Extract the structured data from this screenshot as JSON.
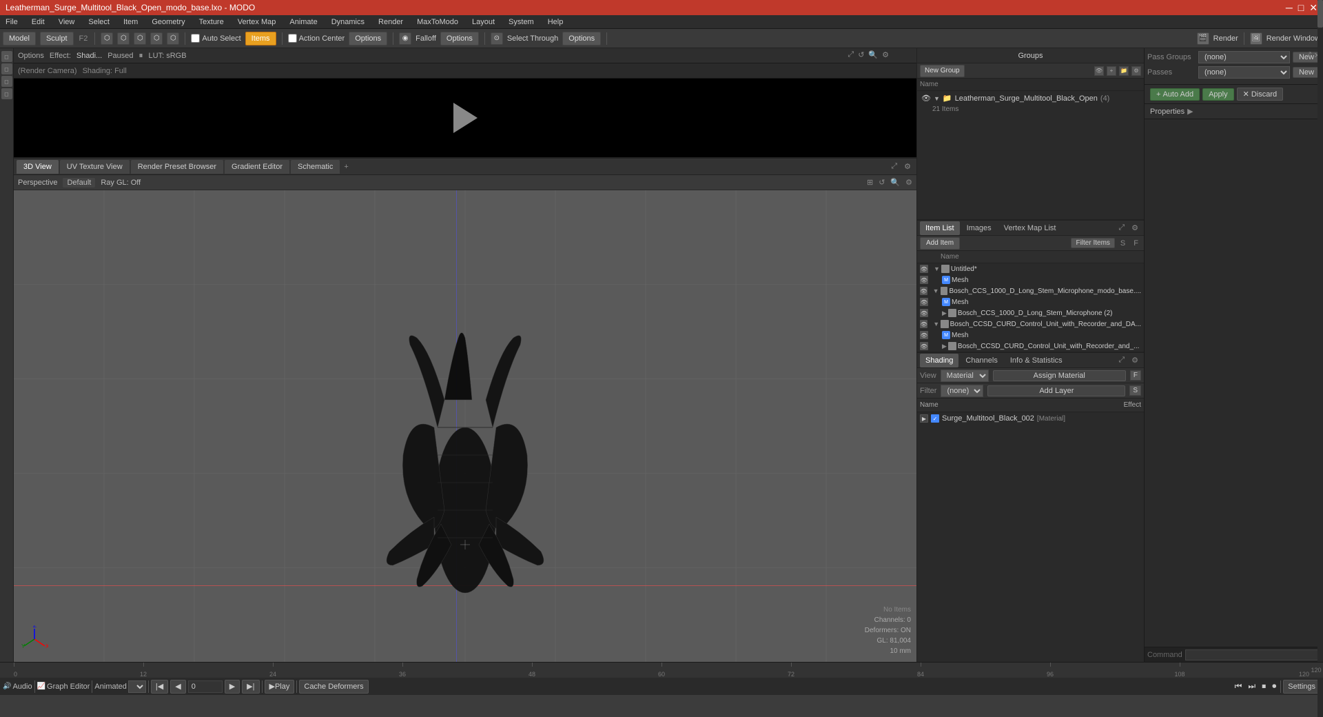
{
  "titlebar": {
    "title": "Leatherman_Surge_Multitool_Black_Open_modo_base.lxo - MODO",
    "controls": [
      "─",
      "□",
      "✕"
    ]
  },
  "menubar": {
    "items": [
      "File",
      "Edit",
      "View",
      "Select",
      "Item",
      "Geometry",
      "Texture",
      "Vertex Map",
      "Animate",
      "Dynamics",
      "Render",
      "MaxToModo",
      "Layout",
      "System",
      "Help"
    ]
  },
  "toolbar": {
    "mode_model": "Model",
    "mode_sculpt": "Sculpt",
    "f2_label": "F2",
    "auto_select_label": "Auto Select",
    "items_label": "Items",
    "action_center_label": "Action Center",
    "options_label": "Options",
    "falloff_label": "Falloff",
    "options2_label": "Options",
    "select_through_label": "Select Through",
    "options3_label": "Options",
    "render_label": "Render",
    "render_window_label": "Render Window"
  },
  "render_toolbar": {
    "options_label": "Options",
    "effect_label": "Effect:",
    "effect_value": "Shadi...",
    "paused_label": "Paused",
    "lut_label": "LUT: sRGB",
    "render_camera_label": "(Render Camera)",
    "shading_label": "Shading: Full"
  },
  "viewport_tabs": {
    "tabs": [
      "3D View",
      "UV Texture View",
      "Render Preset Browser",
      "Gradient Editor",
      "Schematic"
    ],
    "active": "3D View",
    "add_label": "+"
  },
  "viewport_header": {
    "perspective_label": "Perspective",
    "default_label": "Default",
    "ray_gl_label": "Ray GL: Off"
  },
  "viewport_info": {
    "no_items": "No Items",
    "channels": "Channels: 0",
    "deformers": "Deformers: ON",
    "gl": "GL: 81,004",
    "size": "10 mm"
  },
  "groups_panel": {
    "title": "Groups",
    "new_group_btn": "New Group",
    "root_item": "Leatherman_Surge_Multitool_Black_Open",
    "root_count": "(4)",
    "root_sub": "21 Items"
  },
  "items_panel": {
    "tabs": [
      "Item List",
      "Images",
      "Vertex Map List"
    ],
    "active_tab": "Item List",
    "add_item_btn": "Add Item",
    "filter_items_btn": "Filter Items",
    "col_name": "Name",
    "items": [
      {
        "name": "Untitled*",
        "type": "folder",
        "indent": 0,
        "expanded": true
      },
      {
        "name": "Mesh",
        "type": "mesh",
        "indent": 1,
        "expanded": false
      },
      {
        "name": "Bosch_CCS_1000_D_Long_Stem_Microphone_modo_base....",
        "type": "folder",
        "indent": 0,
        "expanded": true
      },
      {
        "name": "Mesh",
        "type": "mesh",
        "indent": 1,
        "expanded": false
      },
      {
        "name": "Bosch_CCS_1000_D_Long_Stem_Microphone (2)",
        "type": "folder",
        "indent": 1,
        "expanded": false
      },
      {
        "name": "Bosch_CCSD_CURD_Control_Unit_with_Recorder_and_DA...",
        "type": "folder",
        "indent": 0,
        "expanded": true
      },
      {
        "name": "Mesh",
        "type": "mesh",
        "indent": 1,
        "expanded": false
      },
      {
        "name": "Bosch_CCSD_CURD_Control_Unit_with_Recorder_and_...",
        "type": "folder",
        "indent": 1,
        "expanded": false
      }
    ]
  },
  "shading_panel": {
    "tabs": [
      "Shading",
      "Channels",
      "Info & Statistics"
    ],
    "active_tab": "Shading",
    "view_label": "View",
    "view_value": "Material",
    "assign_material_btn": "Assign Material",
    "f_label": "F",
    "filter_label": "Filter",
    "filter_value": "(none)",
    "add_layer_btn": "Add Layer",
    "s_label": "S",
    "col_name": "Name",
    "col_effect": "Effect",
    "materials": [
      {
        "name": "Surge_Multitool_Black_002",
        "type": "Material",
        "effect": ""
      }
    ]
  },
  "far_right": {
    "pass_groups_label": "Pass Groups",
    "passes_label": "Passes",
    "none_value": "(none)",
    "new_btn": "New",
    "auto_add_btn": "Auto Add",
    "apply_btn": "Apply",
    "discard_btn": "Discard",
    "properties_label": "Properties",
    "command_label": "Command"
  },
  "playback": {
    "audio_label": "Audio",
    "graph_editor_label": "Graph Editor",
    "animated_label": "Animated",
    "frame_value": "0",
    "play_btn": "Play",
    "cache_deformers_btn": "Cache Deformers",
    "settings_btn": "Settings"
  },
  "timeline": {
    "start": "0",
    "ticks": [
      "0",
      "12",
      "24",
      "36",
      "48",
      "60",
      "72",
      "84",
      "96",
      "108",
      "120"
    ],
    "end": "120"
  }
}
